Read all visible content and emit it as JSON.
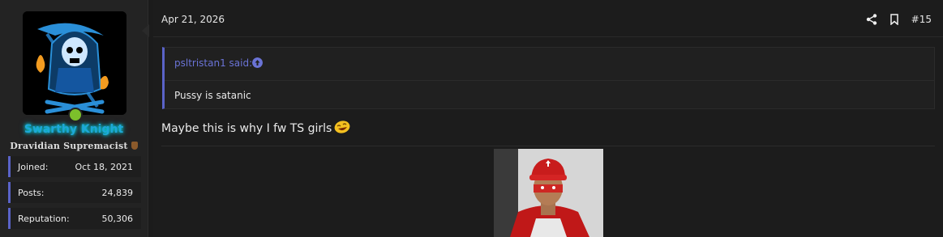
{
  "user": {
    "username": "Swarthy Knight",
    "title": "Dravidian Supremacist",
    "status": "online",
    "stats": [
      {
        "label": "Joined:",
        "value": "Oct 18, 2021"
      },
      {
        "label": "Posts:",
        "value": "24,839"
      },
      {
        "label": "Reputation:",
        "value": "50,306"
      }
    ]
  },
  "post": {
    "date": "Apr 21, 2026",
    "number": "#15",
    "quote": {
      "author": "psltristan1 said:",
      "text": "Pussy is satanic"
    },
    "message": "Maybe this is why I fw TS girls"
  },
  "colors": {
    "accent": "#5a63c8",
    "username": "#1ea7d8",
    "online": "#7cc02b",
    "quote_author": "#6a73d6"
  },
  "icons": [
    "share-icon",
    "bookmark-icon",
    "arrow-up-circle-icon",
    "laughing-emoji-icon",
    "shield-icon"
  ]
}
